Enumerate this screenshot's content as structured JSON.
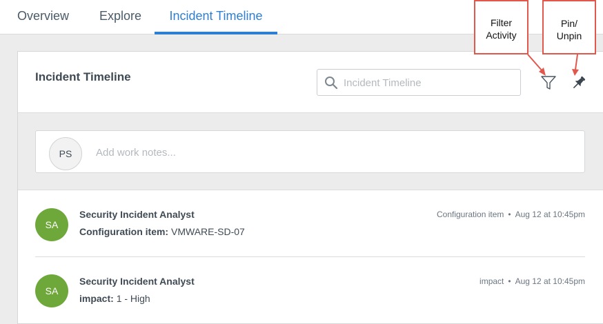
{
  "tabs": [
    {
      "label": "Overview"
    },
    {
      "label": "Explore"
    },
    {
      "label": "Incident Timeline"
    }
  ],
  "card": {
    "title": "Incident Timeline",
    "search_placeholder": "Incident Timeline",
    "filter_icon": "filter-icon",
    "pin_icon": "pin-icon"
  },
  "work_notes": {
    "avatar_initials": "PS",
    "placeholder": "Add work notes..."
  },
  "entries": [
    {
      "avatar_initials": "SA",
      "author": "Security Incident Analyst",
      "field": "Configuration item:",
      "value": "VMWARE-SD-07",
      "meta_field": "Configuration item",
      "separator": "•",
      "timestamp": "Aug 12 at 10:45pm"
    },
    {
      "avatar_initials": "SA",
      "author": "Security Incident Analyst",
      "field": "impact:",
      "value": "1 - High",
      "meta_field": "impact",
      "separator": "•",
      "timestamp": "Aug 12 at 10:45pm"
    }
  ],
  "annotations": {
    "filter_line1": "Filter",
    "filter_line2": "Activity",
    "pin_line1": "Pin/",
    "pin_line2": "Unpin"
  },
  "colors": {
    "accent": "#2e7fd3",
    "avatar_green": "#6fa83a",
    "callout_border": "#e2574c"
  }
}
